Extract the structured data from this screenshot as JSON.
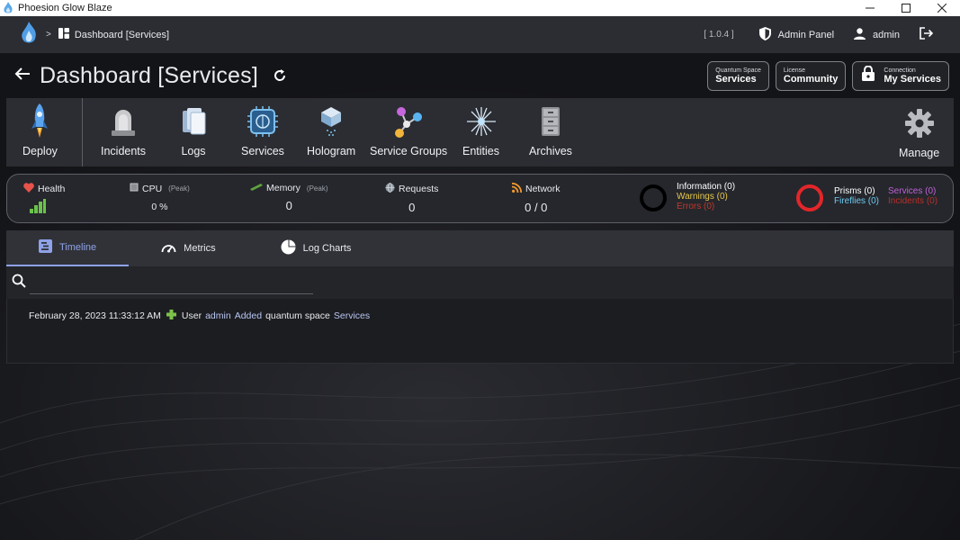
{
  "window": {
    "title": "Phoesion Glow Blaze"
  },
  "navbar": {
    "crumb_sep": ">",
    "crumb": "Dashboard [Services]",
    "version": "[ 1.0.4 ]",
    "admin_panel": "Admin Panel",
    "user": "admin"
  },
  "header": {
    "title": "Dashboard [Services]",
    "pills": {
      "quantum_space": {
        "small": "Quantum Space",
        "big": "Services"
      },
      "license": {
        "small": "License",
        "big": "Community"
      },
      "connection": {
        "small": "Connection",
        "big": "My Services"
      }
    }
  },
  "toolbar": {
    "deploy": "Deploy",
    "incidents": "Incidents",
    "logs": "Logs",
    "services": "Services",
    "hologram": "Hologram",
    "service_groups": "Service Groups",
    "entities": "Entities",
    "archives": "Archives",
    "manage": "Manage"
  },
  "status": {
    "health": {
      "label": "Health"
    },
    "cpu": {
      "label": "CPU",
      "peak": "(Peak)",
      "value": "0 %"
    },
    "memory": {
      "label": "Memory",
      "peak": "(Peak)",
      "value": "0"
    },
    "requests": {
      "label": "Requests",
      "value": "0"
    },
    "network": {
      "label": "Network",
      "value": "0 / 0"
    },
    "log_counts": {
      "information": "Information (0)",
      "warnings": "Warnings (0)",
      "errors": "Errors (0)"
    },
    "entity_counts": {
      "prisms": "Prisms (0)",
      "fireflies": "Fireflies (0)",
      "services": "Services (0)",
      "incidents": "Incidents (0)"
    },
    "colors": {
      "information": "#ffffff",
      "warnings": "#e8c84a",
      "errors": "#c0392b",
      "fireflies": "#6ec9f0",
      "services": "#c061d9",
      "incidents": "#b8302a",
      "ring_ok": "#000000",
      "ring_alert": "#e3262a"
    }
  },
  "tabs": {
    "timeline": "Timeline",
    "metrics": "Metrics",
    "log_charts": "Log Charts"
  },
  "search": {
    "placeholder": ""
  },
  "timeline": {
    "entries": [
      {
        "timestamp": "February 28, 2023 11:33:12 AM",
        "prefix": "User",
        "user": "admin",
        "action": "Added",
        "text": "quantum space",
        "target": "Services"
      }
    ]
  }
}
